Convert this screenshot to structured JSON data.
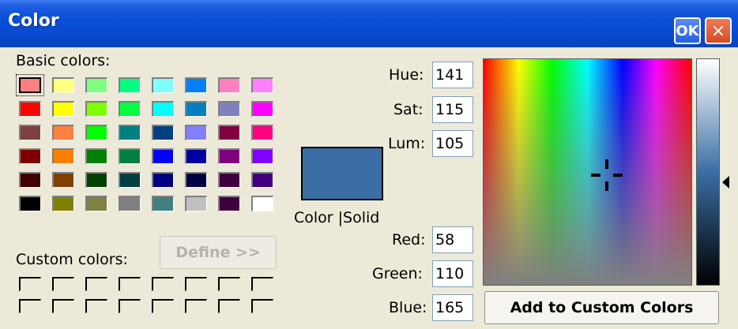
{
  "window": {
    "title": "Color",
    "ok_label": "OK",
    "close_label": "×"
  },
  "basic_colors": {
    "label": "Basic colors:",
    "selected_index": 0,
    "swatches": [
      "#ff8080",
      "#ffff80",
      "#80ff80",
      "#00ff80",
      "#80ffff",
      "#0080ff",
      "#ff80c0",
      "#ff80ff",
      "#ff0000",
      "#ffff00",
      "#80ff00",
      "#00ff40",
      "#00ffff",
      "#0080c0",
      "#8080c0",
      "#ff00ff",
      "#804040",
      "#ff8040",
      "#00ff00",
      "#008080",
      "#004080",
      "#8080ff",
      "#800040",
      "#ff0080",
      "#800000",
      "#ff8000",
      "#008000",
      "#008040",
      "#0000ff",
      "#0000a0",
      "#800080",
      "#8000ff",
      "#400000",
      "#804000",
      "#004000",
      "#004040",
      "#000080",
      "#000040",
      "#400040",
      "#400080",
      "#000000",
      "#808000",
      "#808040",
      "#808080",
      "#408080",
      "#c0c0c0",
      "#400040",
      "#ffffff"
    ]
  },
  "custom_colors": {
    "label": "Custom colors:",
    "define_label": "Define >>",
    "count": 16
  },
  "preview": {
    "label": "Color |Solid",
    "color": "#3a6ea5"
  },
  "fields": {
    "hue": {
      "label": "Hue:",
      "value": "141"
    },
    "sat": {
      "label": "Sat:",
      "value": "115"
    },
    "lum": {
      "label": "Lum:",
      "value": "105"
    },
    "red": {
      "label": "Red:",
      "value": "58"
    },
    "green": {
      "label": "Green:",
      "value": "110"
    },
    "blue": {
      "label": "Blue:",
      "value": "165"
    }
  },
  "add_button_label": "Add to Custom Colors",
  "icons": {
    "ok": "ok-icon",
    "close": "close-icon",
    "crosshair": "crosshair-icon",
    "luminance_pointer": "triangle-left-icon"
  }
}
